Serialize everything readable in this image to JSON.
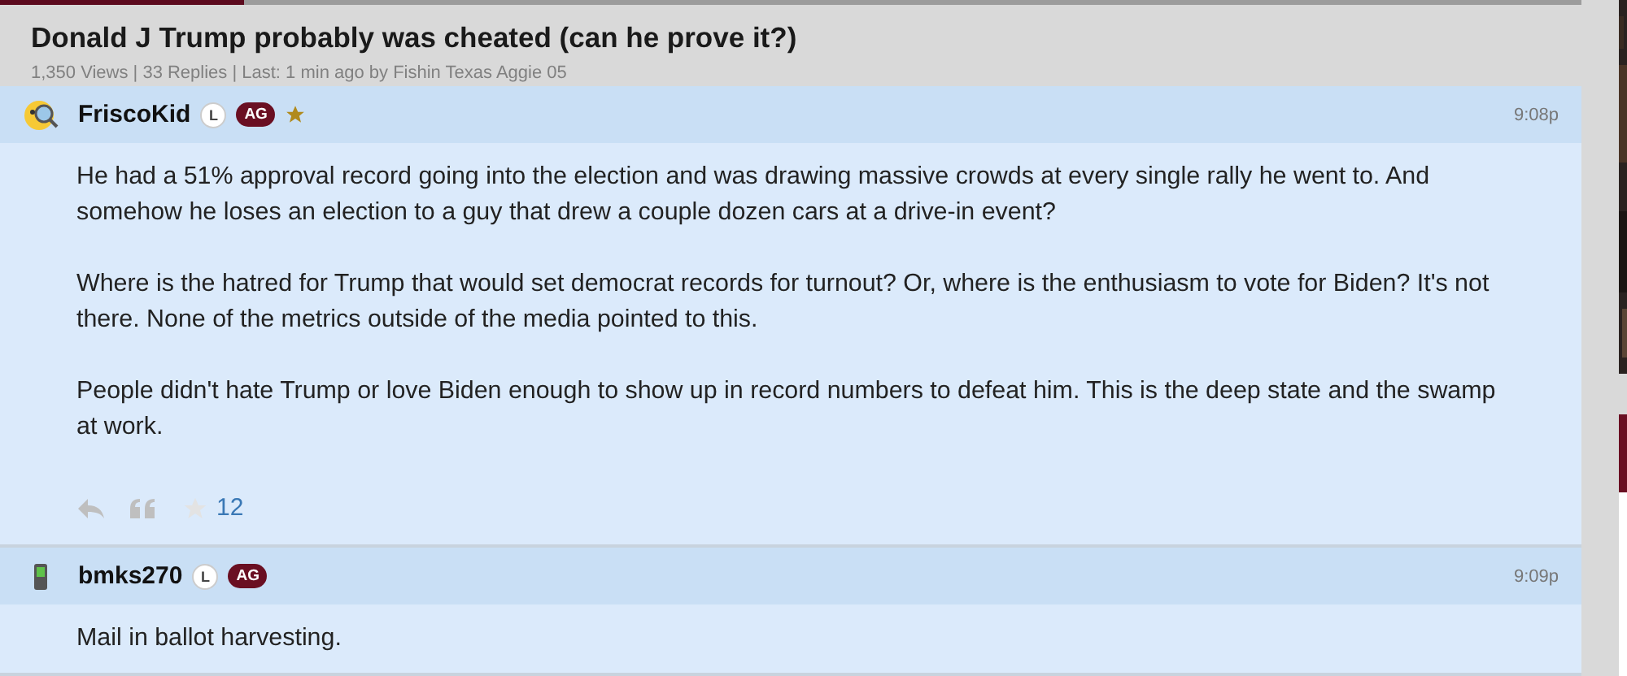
{
  "thread": {
    "title": "Donald J Trump probably was cheated (can he prove it?)",
    "meta": "1,350 Views | 33 Replies | Last: 1 min ago by Fishin Texas Aggie 05"
  },
  "posts": [
    {
      "avatar": {
        "kind": "magnifier"
      },
      "username": "FriscoKid",
      "badges": [
        {
          "kind": "circle",
          "label": "L"
        },
        {
          "kind": "pill",
          "label": "AG"
        }
      ],
      "star": true,
      "time": "9:08p",
      "paragraphs": [
        "He had a 51% approval record going into the election and was drawing massive crowds at every single rally he went to. And somehow he loses an election to a guy that drew a couple dozen cars at a drive-in event?",
        "Where is the hatred for Trump that would set democrat records for turnout? Or, where is the enthusiasm to vote for Biden? It's not there. None of the metrics outside of the media pointed to this.",
        "People didn't hate Trump or love Biden enough to show up in record numbers to defeat him. This is the deep state and the swamp at work."
      ],
      "likes": "12"
    },
    {
      "avatar": {
        "kind": "phone"
      },
      "username": "bmks270",
      "badges": [
        {
          "kind": "circle",
          "label": "L"
        },
        {
          "kind": "pill",
          "label": "AG"
        }
      ],
      "star": false,
      "time": "9:09p",
      "paragraphs": [
        "Mail in ballot harvesting."
      ]
    }
  ]
}
